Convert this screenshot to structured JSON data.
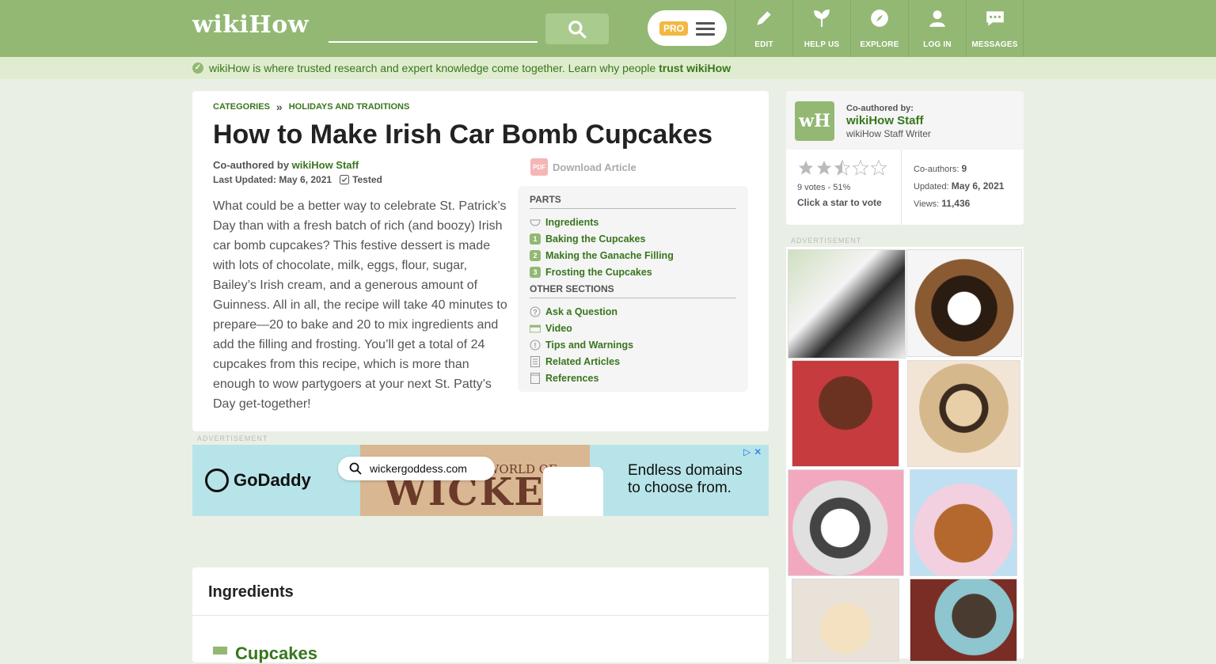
{
  "header": {
    "logo_left": "wiki",
    "logo_right": "How",
    "search_placeholder": "",
    "pro_label": "PRO",
    "nav": [
      {
        "label": "EDIT"
      },
      {
        "label": "HELP US"
      },
      {
        "label": "EXPLORE"
      },
      {
        "label": "LOG IN"
      },
      {
        "label": "MESSAGES"
      }
    ]
  },
  "trust": {
    "text": "wikiHow is where trusted research and expert knowledge come together. Learn why people ",
    "link": "trust wikiHow"
  },
  "breadcrumb": {
    "items": [
      "CATEGORIES",
      "HOLIDAYS AND TRADITIONS"
    ],
    "separator": "»"
  },
  "article": {
    "title": "How to Make Irish Car Bomb Cupcakes",
    "coauthored_prefix": "Co-authored by ",
    "coauthor": "wikiHow Staff",
    "last_updated": "Last Updated: May 6, 2021",
    "tested": "Tested",
    "intro": "What could be a better way to celebrate St. Patrick’s Day than with a fresh batch of rich (and boozy) Irish car bomb cupcakes? This festive dessert is made with lots of chocolate, milk, eggs, flour, sugar, Bailey’s Irish cream, and a generous amount of Guinness. All in all, the recipe will take 40 minutes to prepare—20 to bake and 20 to mix ingredients and add the filling and frosting. You’ll get a total of 24 cupcakes from this recipe, which is more than enough to wow partygoers at your next St. Patty’s Day get-together!",
    "download": "Download Article",
    "pdf_label": "PDF"
  },
  "toc": {
    "parts_heading": "PARTS",
    "ingredients": "Ingredients",
    "parts": [
      {
        "num": "1",
        "label": "Baking the Cupcakes"
      },
      {
        "num": "2",
        "label": "Making the Ganache Filling"
      },
      {
        "num": "3",
        "label": "Frosting the Cupcakes"
      }
    ],
    "other_heading": "OTHER SECTIONS",
    "other": [
      {
        "icon": "question-icon",
        "label": "Ask a Question"
      },
      {
        "icon": "video-icon",
        "label": "Video"
      },
      {
        "icon": "warning-icon",
        "label": "Tips and Warnings"
      },
      {
        "icon": "document-icon",
        "label": "Related Articles"
      },
      {
        "icon": "book-icon",
        "label": "References"
      }
    ]
  },
  "ads": {
    "label": "ADVERTISEMENT",
    "banner": {
      "brand": "GoDaddy",
      "search_text": "wickergoddess.com",
      "mid_text": "WICKER",
      "mid_small": "WORLD OF",
      "tagline_1": "Endless domains",
      "tagline_2": "to choose from."
    }
  },
  "ingredients_section": {
    "title": "Ingredients",
    "subtitle": "Cupcakes"
  },
  "author_card": {
    "label": "Co-authored by:",
    "name": "wikiHow Staff",
    "role": "wikiHow Staff Writer",
    "avatar_text": "wH",
    "rating_fraction": 0.51,
    "votes": "9 votes - 51%",
    "click_to_vote": "Click a star to vote",
    "coauthors_label": "Co-authors: ",
    "coauthors": "9",
    "updated_label": "Updated: ",
    "updated": "May 6, 2021",
    "views_label": "Views: ",
    "views": "11,436"
  },
  "colors": {
    "header": "#93b874",
    "link": "#38761d",
    "trustbar": "#e0eccf"
  }
}
